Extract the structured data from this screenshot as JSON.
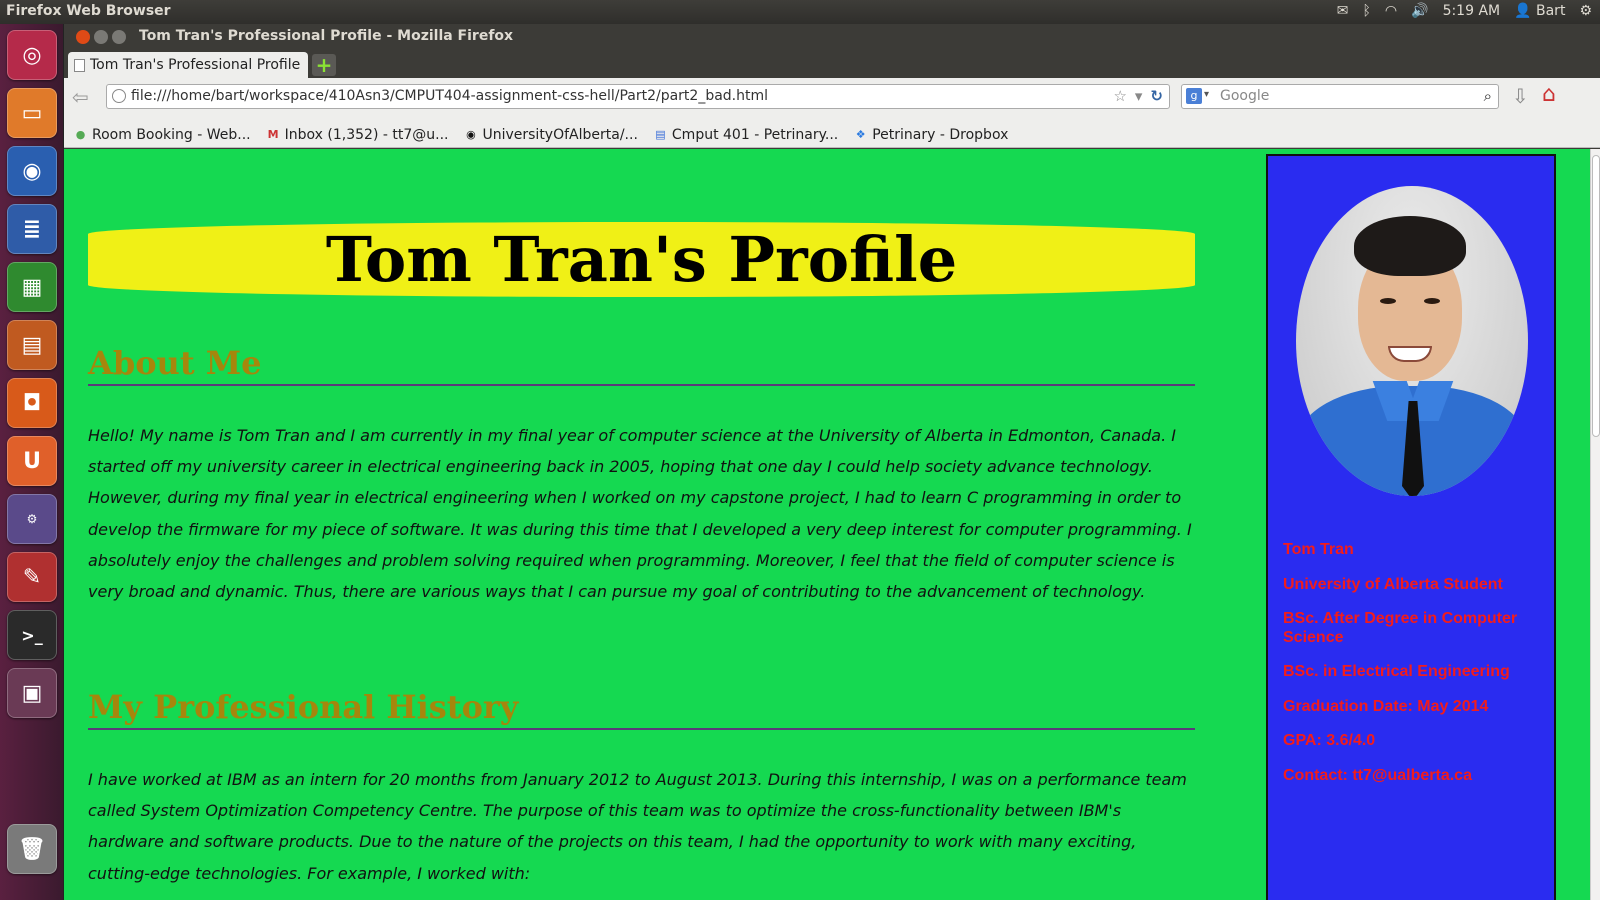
{
  "top_panel": {
    "title": "Firefox Web Browser",
    "time": "5:19 AM",
    "user": "Bart"
  },
  "window": {
    "title": "Tom Tran's Professional Profile - Mozilla Firefox"
  },
  "tab": {
    "label": "Tom Tran's Professional Profile"
  },
  "navbar": {
    "url": "file:///home/bart/workspace/410Asn3/CMPUT404-assignment-css-hell/Part2/part2_bad.html",
    "search_placeholder": "Google"
  },
  "bookmarks": [
    {
      "label": "Room Booking - Web...",
      "icon": "leaf-icon"
    },
    {
      "label": "Inbox (1,352) - tt7@u...",
      "icon": "gmail-icon"
    },
    {
      "label": "UniversityOfAlberta/...",
      "icon": "github-icon"
    },
    {
      "label": "Cmput 401 - Petrinary...",
      "icon": "docs-icon"
    },
    {
      "label": "Petrinary - Dropbox",
      "icon": "dropbox-icon"
    }
  ],
  "page": {
    "title": "Tom Tran's Profile",
    "about_heading": "About Me",
    "about_text": "Hello! My name is Tom Tran and I am currently in my final year of computer science at the University of Alberta in Edmonton, Canada. I started off my university career in electrical engineering back in 2005, hoping that one day I could help society advance technology. However, during my final year in electrical engineering when I worked on my capstone project, I had to learn C programming in order to develop the firmware for my piece of software. It was during this time that I developed a very deep interest for computer programming. I absolutely enjoy the challenges and problem solving required when programming. Moreover, I feel that the field of computer science is very broad and dynamic. Thus, there are various ways that I can pursue my goal of contributing to the advancement of technology.",
    "history_heading": "My Professional History",
    "history_text": "I have worked at IBM as an intern for 20 months from January 2012 to August 2013. During this internship, I was on a performance team called System Optimization Competency Centre. The purpose of this team was to optimize the cross-functionality between IBM's hardware and software products. Due to the nature of the projects on this team, I had the opportunity to work with many exciting, cutting-edge technologies. For example, I worked with:"
  },
  "sidebar": {
    "lines": [
      "Tom Tran",
      "University of Alberta Student",
      "BSc. After Degree in Computer Science",
      "BSc. in Electrical Engineering",
      "Graduation Date: May 2014",
      "GPA: 3.6/4.0",
      "Contact: tt7@ualberta.ca"
    ]
  },
  "colors": {
    "page_bg": "#15d951",
    "banner_bg": "#f0f016",
    "heading": "#a6860c",
    "sidebar_bg": "#2a2cf0",
    "sidebar_text": "#f21c1c"
  }
}
